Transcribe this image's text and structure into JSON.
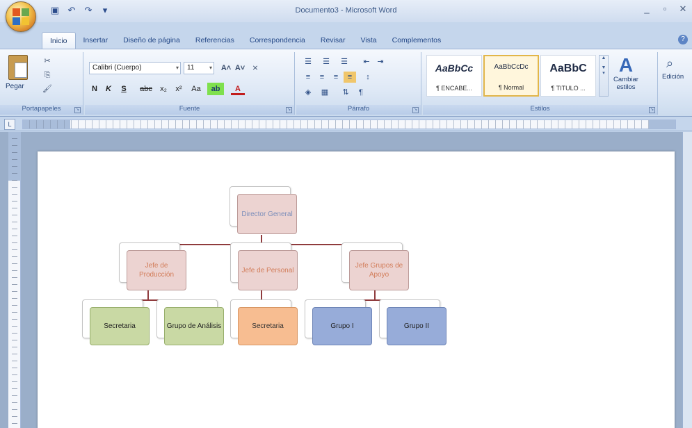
{
  "window": {
    "title": "Documento3 - Microsoft Word",
    "controls": [
      "_",
      "▫",
      "✕"
    ]
  },
  "qat": {
    "save": "▣",
    "undo": "↶",
    "redo": "↷",
    "more": "▾"
  },
  "tabs": [
    "Inicio",
    "Insertar",
    "Diseño de página",
    "Referencias",
    "Correspondencia",
    "Revisar",
    "Vista",
    "Complementos"
  ],
  "ribbon": {
    "clipboard": {
      "paste_label": "Pegar",
      "group_label": "Portapapeles"
    },
    "font": {
      "font_name": "Calibri (Cuerpo)",
      "font_size": "11",
      "grow": "A˄",
      "shrink": "A˅",
      "clear": "⨯",
      "bold": "N",
      "italic": "K",
      "underline": "S",
      "strike": "abc",
      "subscript": "x₂",
      "superscript": "x²",
      "case": "Aa",
      "highlight": "ab",
      "color": "A",
      "group_label": "Fuente"
    },
    "paragraph": {
      "group_label": "Párrafo",
      "sort": "⇅",
      "pilcrow": "¶"
    },
    "styles": {
      "items": [
        {
          "sample": "AaBbCc",
          "name": "¶ ENCABE..."
        },
        {
          "sample": "AaBbCcDc",
          "name": "¶ Normal"
        },
        {
          "sample": "AaBbC",
          "name": "¶ TITULO ..."
        }
      ],
      "change_styles": "Cambiar estilos",
      "group_label": "Estilos"
    },
    "editing": {
      "label": "Edición"
    }
  },
  "org_chart": {
    "root": "Director General",
    "level2": [
      "Jefe de Producción",
      "Jefe de Personal",
      "Jefe Grupos de Apoyo"
    ],
    "level3": [
      "Secretaria",
      "Grupo de Análisis",
      "Secretaria",
      "Grupo I",
      "Grupo II"
    ]
  },
  "colors": {
    "pink": "#ecd3d1",
    "green": "#c9d9a4",
    "orange": "#f7bd91",
    "blue": "#97acd9",
    "connector": "#8f3b3d"
  }
}
